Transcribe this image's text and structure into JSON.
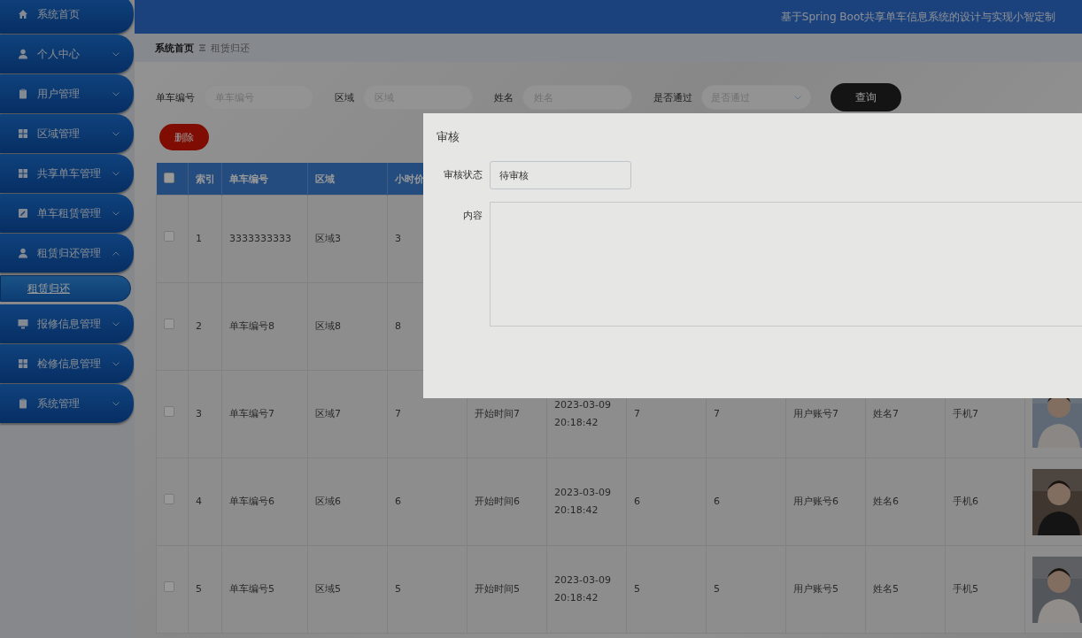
{
  "header": {
    "title": "基于Spring Boot共享单车信息系统的设计与实现小智定制"
  },
  "sidebar": {
    "items": [
      {
        "label": "系统首页",
        "kind": "link"
      },
      {
        "label": "个人中心",
        "kind": "menu",
        "expanded": false
      },
      {
        "label": "用户管理",
        "kind": "menu",
        "expanded": false
      },
      {
        "label": "区域管理",
        "kind": "menu",
        "expanded": false
      },
      {
        "label": "共享单车管理",
        "kind": "menu",
        "expanded": false
      },
      {
        "label": "单车租赁管理",
        "kind": "menu",
        "expanded": false
      },
      {
        "label": "租赁归还管理",
        "kind": "menu",
        "expanded": true,
        "children": [
          {
            "label": "租赁归还",
            "selected": true
          }
        ]
      },
      {
        "label": "报修信息管理",
        "kind": "menu",
        "expanded": false
      },
      {
        "label": "检修信息管理",
        "kind": "menu",
        "expanded": false
      },
      {
        "label": "系统管理",
        "kind": "menu",
        "expanded": false
      }
    ]
  },
  "breadcrumb": [
    {
      "label": "系统首页"
    },
    {
      "label": "租赁归还"
    }
  ],
  "search": {
    "fields": [
      {
        "label": "单车编号",
        "placeholder": "单车编号",
        "kind": "input"
      },
      {
        "label": "区域",
        "placeholder": "区域",
        "kind": "input"
      },
      {
        "label": "姓名",
        "placeholder": "姓名",
        "kind": "input"
      },
      {
        "label": "是否通过",
        "placeholder": "是否通过",
        "kind": "select"
      }
    ],
    "button": "查询"
  },
  "delete_button": "删除",
  "table": {
    "header_checked": false,
    "columns": [
      "索引",
      "单车编号",
      "区域",
      "小时价"
    ],
    "rows": [
      {
        "checked": false,
        "cells": [
          "1",
          "3333333333",
          "区域3",
          "3"
        ]
      },
      {
        "checked": false,
        "cells": [
          "2",
          "单车编号8",
          "区域8",
          "8"
        ]
      },
      {
        "checked": false,
        "cells": [
          "3",
          "单车编号7",
          "区域7",
          "7",
          "开始时间7",
          "2023-03-09 20:18:42",
          "7",
          "7",
          "用户账号7",
          "姓名7",
          "手机7"
        ]
      },
      {
        "checked": false,
        "cells": [
          "4",
          "单车编号6",
          "区域6",
          "6",
          "开始时间6",
          "2023-03-09 20:18:42",
          "6",
          "6",
          "用户账号6",
          "姓名6",
          "手机6"
        ]
      },
      {
        "checked": false,
        "cells": [
          "5",
          "单车编号5",
          "区域5",
          "5",
          "开始时间5",
          "2023-03-09 20:18:42",
          "5",
          "5",
          "用户账号5",
          "姓名5",
          "手机5"
        ]
      }
    ]
  },
  "dialog": {
    "title": "审核",
    "fields": [
      {
        "label": "审核状态",
        "kind": "select",
        "value": "待审核"
      },
      {
        "label": "内容",
        "kind": "textarea"
      }
    ]
  }
}
